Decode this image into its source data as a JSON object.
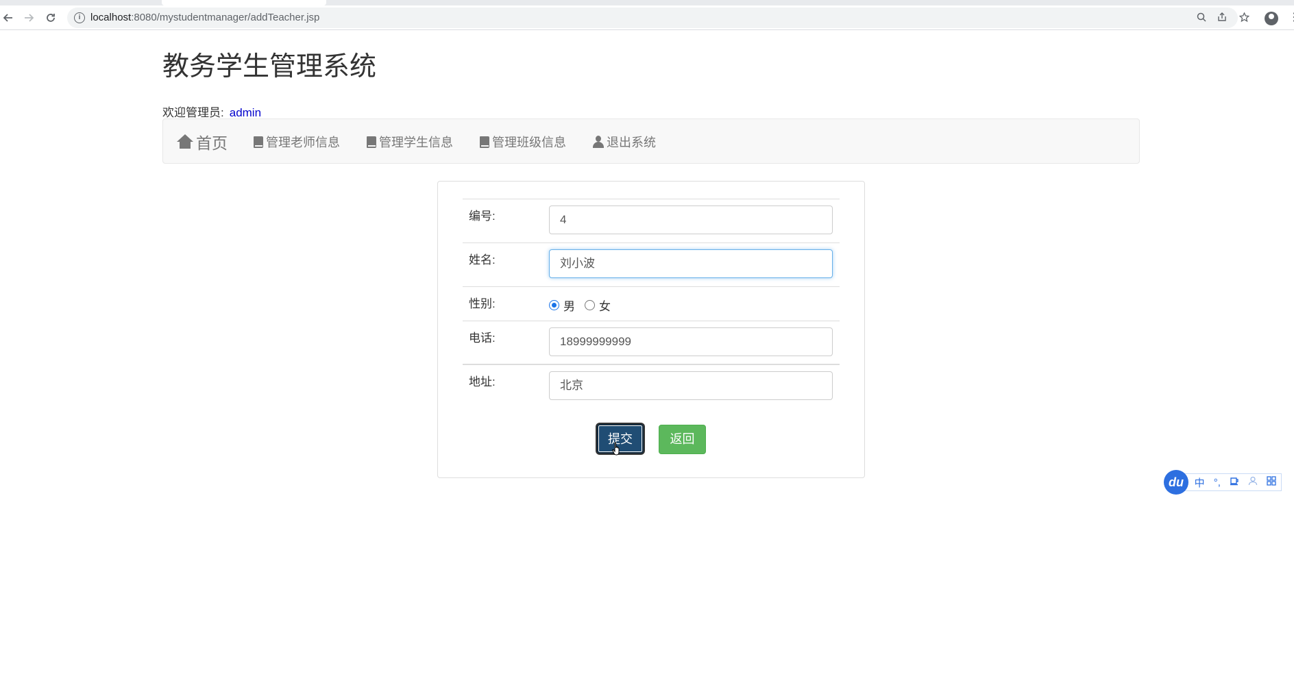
{
  "browser": {
    "url_host": "localhost",
    "url_rest": ":8080/mystudentmanager/addTeacher.jsp"
  },
  "page": {
    "title": "教务学生管理系统",
    "welcome_label": "欢迎管理员:",
    "admin_name": "admin"
  },
  "navbar": {
    "home": "首页",
    "items": [
      {
        "label": "管理老师信息",
        "icon": "book-icon"
      },
      {
        "label": "管理学生信息",
        "icon": "book-icon"
      },
      {
        "label": "管理班级信息",
        "icon": "book-icon"
      },
      {
        "label": "退出系统",
        "icon": "user-icon"
      }
    ]
  },
  "form": {
    "id_label": "编号:",
    "id_value": "4",
    "name_label": "姓名:",
    "name_value": "刘小波",
    "gender_label": "性别:",
    "gender_options": [
      "男",
      "女"
    ],
    "gender_selected": "男",
    "phone_label": "电话:",
    "phone_value": "18999999999",
    "address_label": "地址:",
    "address_value": "北京",
    "submit_label": "提交",
    "back_label": "返回"
  },
  "ime": {
    "logo": "du",
    "lang": "中",
    "punct": "°,"
  },
  "colors": {
    "submit_bg": "#204d74",
    "back_bg": "#5cb85c",
    "admin_link": "#0000cc",
    "navbar_bg": "#f8f8f8"
  }
}
